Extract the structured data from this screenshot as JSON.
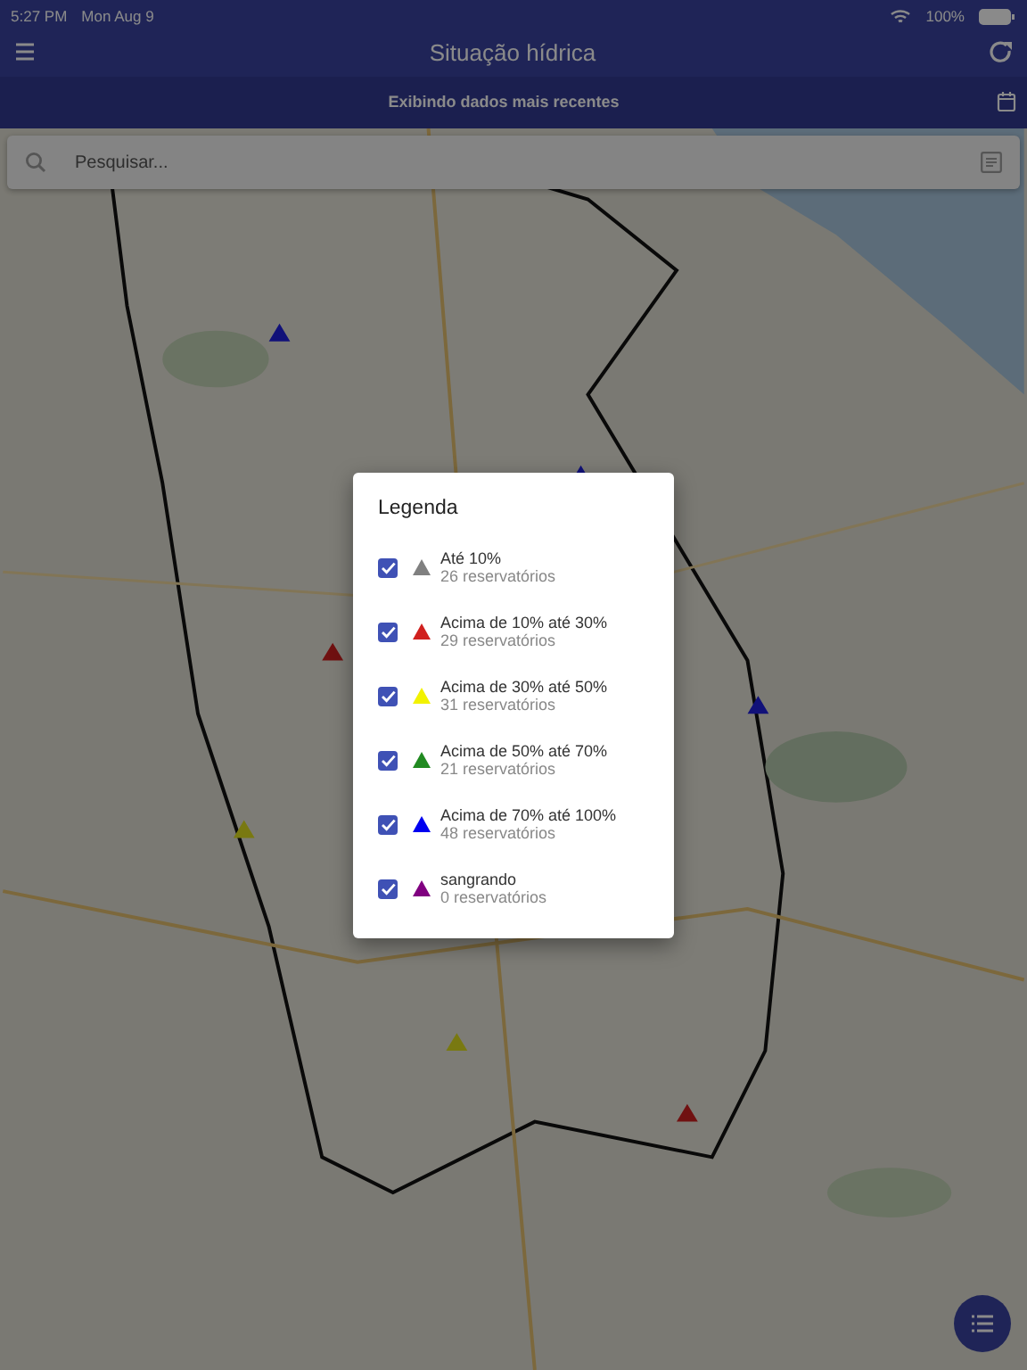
{
  "status_bar": {
    "time": "5:27 PM",
    "date": "Mon Aug 9",
    "battery": "100%"
  },
  "header": {
    "title": "Situação hídrica",
    "subtitle": "Exibindo dados mais recentes"
  },
  "search": {
    "placeholder": "Pesquisar..."
  },
  "legend": {
    "title": "Legenda",
    "items": [
      {
        "label": "Até 10%",
        "count": "26 reservatórios",
        "checked": true,
        "color": "#808080"
      },
      {
        "label": "Acima de 10% até 30%",
        "count": "29 reservatórios",
        "checked": true,
        "color": "#d0201e"
      },
      {
        "label": "Acima de 30% até 50%",
        "count": "31 reservatórios",
        "checked": true,
        "color": "#f2f200"
      },
      {
        "label": "Acima de 50% até 70%",
        "count": "21 reservatórios",
        "checked": true,
        "color": "#218a21"
      },
      {
        "label": "Acima de 70% até 100%",
        "count": "48 reservatórios",
        "checked": true,
        "color": "#0000f0"
      },
      {
        "label": "sangrando",
        "count": "0 reservatórios",
        "checked": true,
        "color": "#800080"
      }
    ]
  }
}
